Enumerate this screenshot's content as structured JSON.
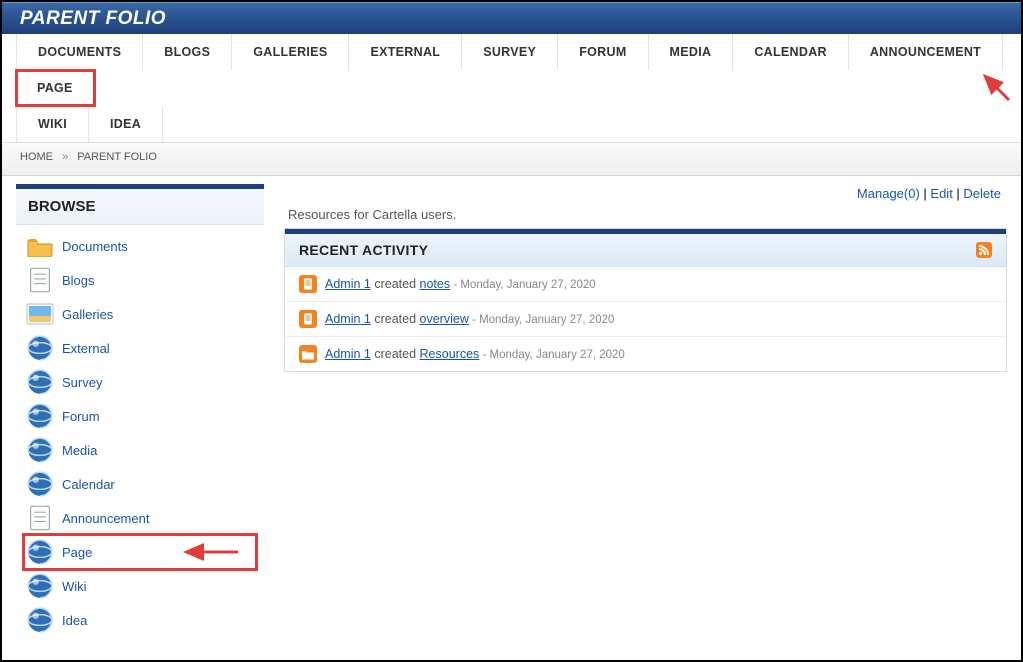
{
  "header": {
    "title": "PARENT FOLIO"
  },
  "topnav": {
    "row1": [
      {
        "label": "DOCUMENTS"
      },
      {
        "label": "BLOGS"
      },
      {
        "label": "GALLERIES"
      },
      {
        "label": "EXTERNAL"
      },
      {
        "label": "SURVEY"
      },
      {
        "label": "FORUM"
      },
      {
        "label": "MEDIA"
      },
      {
        "label": "CALENDAR"
      },
      {
        "label": "ANNOUNCEMENT"
      },
      {
        "label": "PAGE",
        "highlight": true
      }
    ],
    "row2": [
      {
        "label": "WIKI"
      },
      {
        "label": "IDEA"
      }
    ]
  },
  "breadcrumb": {
    "home": "HOME",
    "sep": "»",
    "current": "PARENT FOLIO"
  },
  "sidebar": {
    "title": "BROWSE",
    "items": [
      {
        "label": "Documents",
        "icon": "folder"
      },
      {
        "label": "Blogs",
        "icon": "doc"
      },
      {
        "label": "Galleries",
        "icon": "image"
      },
      {
        "label": "External",
        "icon": "globe"
      },
      {
        "label": "Survey",
        "icon": "globe"
      },
      {
        "label": "Forum",
        "icon": "globe"
      },
      {
        "label": "Media",
        "icon": "globe"
      },
      {
        "label": "Calendar",
        "icon": "globe"
      },
      {
        "label": "Announcement",
        "icon": "doc"
      },
      {
        "label": "Page",
        "icon": "globe",
        "highlight": true
      },
      {
        "label": "Wiki",
        "icon": "globe"
      },
      {
        "label": "Idea",
        "icon": "globe"
      }
    ]
  },
  "actions": {
    "manage": "Manage(0)",
    "edit": "Edit",
    "delete": "Delete",
    "sep": " | "
  },
  "caption": "Resources for Cartella users.",
  "panel": {
    "title": "RECENT ACTIVITY",
    "rows": [
      {
        "icon": "page",
        "user": "Admin 1",
        "verb": "created",
        "obj": "notes",
        "dash": " - ",
        "date": "Monday, January 27, 2020"
      },
      {
        "icon": "page",
        "user": "Admin 1",
        "verb": "created",
        "obj": "overview",
        "dash": " - ",
        "date": "Monday, January 27, 2020"
      },
      {
        "icon": "folder",
        "user": "Admin 1",
        "verb": "created",
        "obj": "Resources",
        "dash": " - ",
        "date": "Monday, January 27, 2020"
      }
    ]
  }
}
